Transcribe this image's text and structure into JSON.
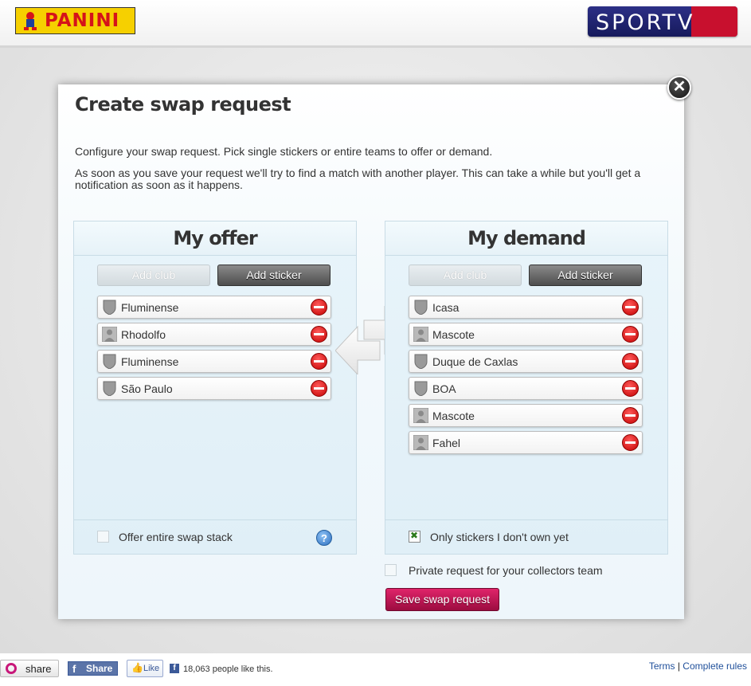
{
  "header": {
    "left_logo": "PANINI",
    "right_logo_part1": "SPOR",
    "right_logo_part2": "TV"
  },
  "modal": {
    "title": "Create swap request",
    "close_label": "✕",
    "intro_line1": "Configure your swap request. Pick single stickers or entire teams to offer or demand.",
    "intro_line2": "As soon as you save your request we'll try to find a match with another player. This can take a while but you'll get a notification as soon as it happens.",
    "offer": {
      "title": "My offer",
      "add_club": "Add club",
      "add_sticker": "Add sticker",
      "items": [
        {
          "type": "club-shield-icon",
          "label": "Fluminense"
        },
        {
          "type": "player-icon",
          "label": "Rhodolfo"
        },
        {
          "type": "club-shield-icon",
          "label": "Fluminense"
        },
        {
          "type": "club-shield-icon",
          "label": "São Paulo"
        }
      ],
      "footer_label": "Offer entire swap stack",
      "footer_checked": false,
      "help": "?"
    },
    "demand": {
      "title": "My demand",
      "add_club": "Add club",
      "add_sticker": "Add sticker",
      "items": [
        {
          "type": "club-shield-icon",
          "label": "Icasa"
        },
        {
          "type": "player-icon",
          "label": "Mascote"
        },
        {
          "type": "club-shield-icon",
          "label": "Duque de Caxlas"
        },
        {
          "type": "club-shield-icon",
          "label": "BOA"
        },
        {
          "type": "player-icon",
          "label": "Mascote"
        },
        {
          "type": "player-icon",
          "label": "Fahel"
        }
      ],
      "footer_label": "Only stickers I don't own yet",
      "footer_checked": true
    },
    "private_label": "Private request for your collectors team",
    "private_checked": false,
    "save_label": "Save swap request"
  },
  "footer": {
    "share": "share",
    "fb_f": "f",
    "fb_share": "Share",
    "like": "Like",
    "like_count": "18,063 people like this.",
    "terms": "Terms",
    "separator": "|",
    "rules": "Complete rules"
  },
  "colors": {
    "accent_save": "#c4154f",
    "remove_red": "#d40000",
    "check_green": "#2d7a1a",
    "facebook": "#3b5998"
  }
}
